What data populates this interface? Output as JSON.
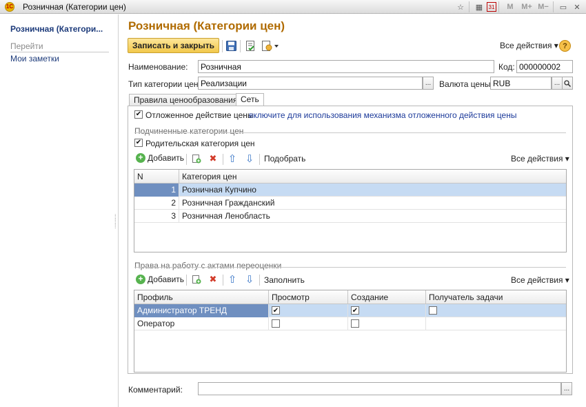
{
  "window": {
    "title": "Розничная (Категории цен)",
    "app_logo": "1С",
    "tools": {
      "memory_labels": [
        "M",
        "M+",
        "M−"
      ],
      "calendar_day": "31"
    }
  },
  "left_panel": {
    "title": "Розничная (Категори...",
    "goto_label": "Перейти",
    "notes_link": "Мои заметки"
  },
  "form": {
    "title": "Розничная (Категории цен)",
    "save_close_label": "Записать и закрыть",
    "all_actions_label": "Все действия ▾",
    "help_label": "?",
    "name_label": "Наименование:",
    "name_value": "Розничная",
    "code_label": "Код:",
    "code_value": "000000002",
    "category_type_label": "Тип категории цен:",
    "category_type_value": "Реализации",
    "currency_label": "Валюта цены:",
    "currency_value": "RUB",
    "select_btn": "...",
    "comment_label": "Комментарий:",
    "comment_value": ""
  },
  "tabs": [
    {
      "label": "Правила ценообразования",
      "active": false
    },
    {
      "label": "Сеть",
      "active": true
    }
  ],
  "network_tab": {
    "deferred_action_label": "Отложенное действие цены",
    "deferred_action_checked": true,
    "deferred_action_link": "включите для использования механизма отложенного действия цены",
    "sub_categories_section": "Подчиненные категории цен",
    "parent_category_label": "Родительская категория цен",
    "parent_category_checked": true,
    "toolbar1": {
      "add_label": "Добавить",
      "pick_label": "Подобрать",
      "all_actions_label": "Все действия ▾"
    },
    "categories_grid": {
      "columns": [
        "N",
        "Категория цен"
      ],
      "rows": [
        {
          "n": "1",
          "name": "Розничная Купчино",
          "selected": true
        },
        {
          "n": "2",
          "name": "Розничная Гражданский",
          "selected": false
        },
        {
          "n": "3",
          "name": "Розничная Ленобласть",
          "selected": false
        }
      ]
    },
    "revaluation_section": "Права на работу с актами переоценки",
    "toolbar2": {
      "add_label": "Добавить",
      "fill_label": "Заполнить",
      "all_actions_label": "Все действия ▾"
    },
    "rights_grid": {
      "columns": [
        "Профиль",
        "Просмотр",
        "Создание",
        "Получатель задачи"
      ],
      "rows": [
        {
          "profile": "Администратор ТРЕНД",
          "view": true,
          "create": true,
          "recipient": false,
          "selected": true
        },
        {
          "profile": "Оператор",
          "view": false,
          "create": false,
          "recipient": null,
          "selected": false
        }
      ]
    }
  },
  "icons": {
    "check": "✔",
    "delete": "✖",
    "up": "⇧",
    "down": "⇩",
    "search": "⌕"
  },
  "colors": {
    "title_orange": "#b06b00",
    "link_blue": "#1c3a9a",
    "button_yellow": "#f2c84b",
    "row_selected": "#c6dbf3",
    "cell_current": "#6f8fc0"
  }
}
